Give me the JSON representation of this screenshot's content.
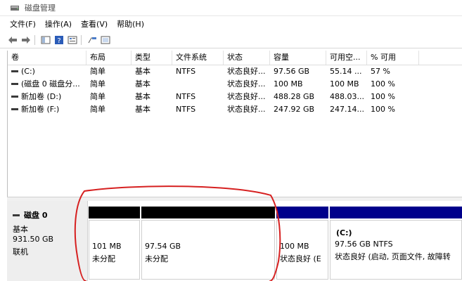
{
  "window": {
    "title": "磁盘管理"
  },
  "menu": [
    "文件(F)",
    "操作(A)",
    "查看(V)",
    "帮助(H)"
  ],
  "toolbar": [
    "back-arrow-icon",
    "forward-arrow-icon",
    "console-tree-icon",
    "help-icon",
    "properties-icon",
    "disk-list-icon",
    "settings-icon"
  ],
  "columns": [
    "卷",
    "布局",
    "类型",
    "文件系统",
    "状态",
    "容量",
    "可用空...",
    "% 可用"
  ],
  "volumes": [
    [
      "(C:)",
      "简单",
      "基本",
      "NTFS",
      "状态良好...",
      "97.56 GB",
      "55.14 ...",
      "57 %"
    ],
    [
      "(磁盘 0 磁盘分...",
      "简单",
      "基本",
      "",
      "状态良好...",
      "100 MB",
      "100 MB",
      "100 %"
    ],
    [
      "新加卷 (D:)",
      "简单",
      "基本",
      "NTFS",
      "状态良好...",
      "488.28 GB",
      "488.03...",
      "100 %"
    ],
    [
      "新加卷 (F:)",
      "简单",
      "基本",
      "NTFS",
      "状态良好...",
      "247.92 GB",
      "247.14...",
      "100 %"
    ]
  ],
  "disk0": {
    "name": "磁盘 0",
    "type": "基本",
    "size": "931.50 GB",
    "status": "联机",
    "partitions": [
      {
        "size": "101 MB",
        "status": "未分配"
      },
      {
        "size": "97.54 GB",
        "status": "未分配"
      },
      {
        "size": "100 MB",
        "status": "状态良好 (E"
      },
      {
        "label": "(C:)",
        "size": "97.56 GB NTFS",
        "status": "状态良好 (启动, 页面文件, 故障转"
      }
    ]
  },
  "colors": {
    "unallocated_bar": "#000000",
    "primary_bar": "#00008b",
    "annotation": "#d62020"
  }
}
